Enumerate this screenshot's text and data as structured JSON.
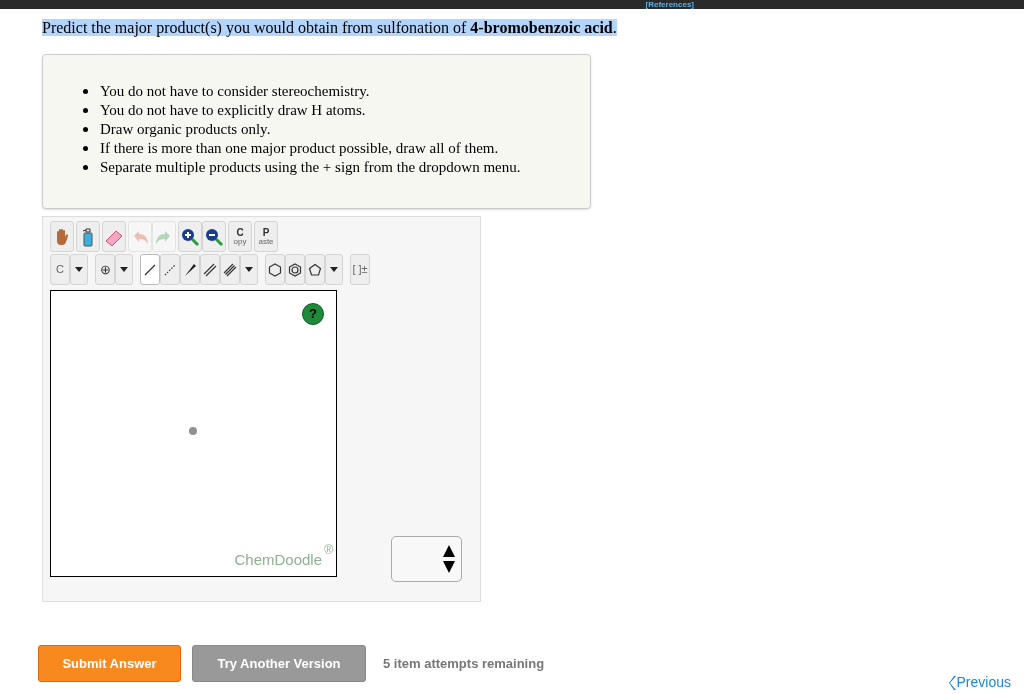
{
  "header": {
    "link": "[References]"
  },
  "question": "Predict the major product(s) you would obtain from sulfonation of **4-bromobenzoic acid**.",
  "instructions": [
    "You do not have to consider stereochemistry.",
    "You do not have to explicitly draw H atoms.",
    "Draw organic products only.",
    "If there is more than one major product possible, draw all of them.",
    "Separate multiple products using the + sign from the dropdown menu."
  ],
  "toolbar_top": [
    {
      "kind": "hand",
      "disabled": false
    },
    {
      "kind": "bottle",
      "disabled": false
    },
    {
      "kind": "eraser",
      "disabled": false
    },
    {
      "kind": "undo",
      "disabled": true
    },
    {
      "kind": "redo",
      "disabled": true
    },
    {
      "kind": "zoom-in",
      "disabled": false
    },
    {
      "kind": "zoom-out",
      "disabled": false
    },
    {
      "kind": "copy",
      "big": "C",
      "small": "opy",
      "disabled": false
    },
    {
      "kind": "paste",
      "big": "P",
      "small": "aste",
      "disabled": false
    }
  ],
  "toolbar_bottom": [
    {
      "kind": "label",
      "text": "C",
      "selected": false
    },
    {
      "kind": "caret",
      "selected": false
    },
    {
      "kind": "plus",
      "text": "⊕",
      "selected": false
    },
    {
      "kind": "caret",
      "selected": false
    },
    {
      "kind": "single-bond",
      "selected": true
    },
    {
      "kind": "dashed-bond",
      "selected": false
    },
    {
      "kind": "wedge-bond",
      "selected": false
    },
    {
      "kind": "double-bond",
      "selected": false
    },
    {
      "kind": "triple-bond",
      "selected": false
    },
    {
      "kind": "caret",
      "selected": false
    },
    {
      "kind": "hexagon",
      "selected": false
    },
    {
      "kind": "aromatic-ring",
      "selected": false
    },
    {
      "kind": "pentagon",
      "selected": false
    },
    {
      "kind": "caret",
      "selected": false
    },
    {
      "kind": "label",
      "text": "[ ]±",
      "selected": false
    }
  ],
  "canvas": {
    "help": "?",
    "brand": "ChemDoodle",
    "brand_mark": "®"
  },
  "buttons": [
    {
      "label": "Submit Answer",
      "kind": "primary"
    },
    {
      "label": "Try Another Version",
      "kind": "secondary"
    }
  ],
  "attempts": "5 item attempts remaining",
  "nav": {
    "previous": "Previous"
  }
}
